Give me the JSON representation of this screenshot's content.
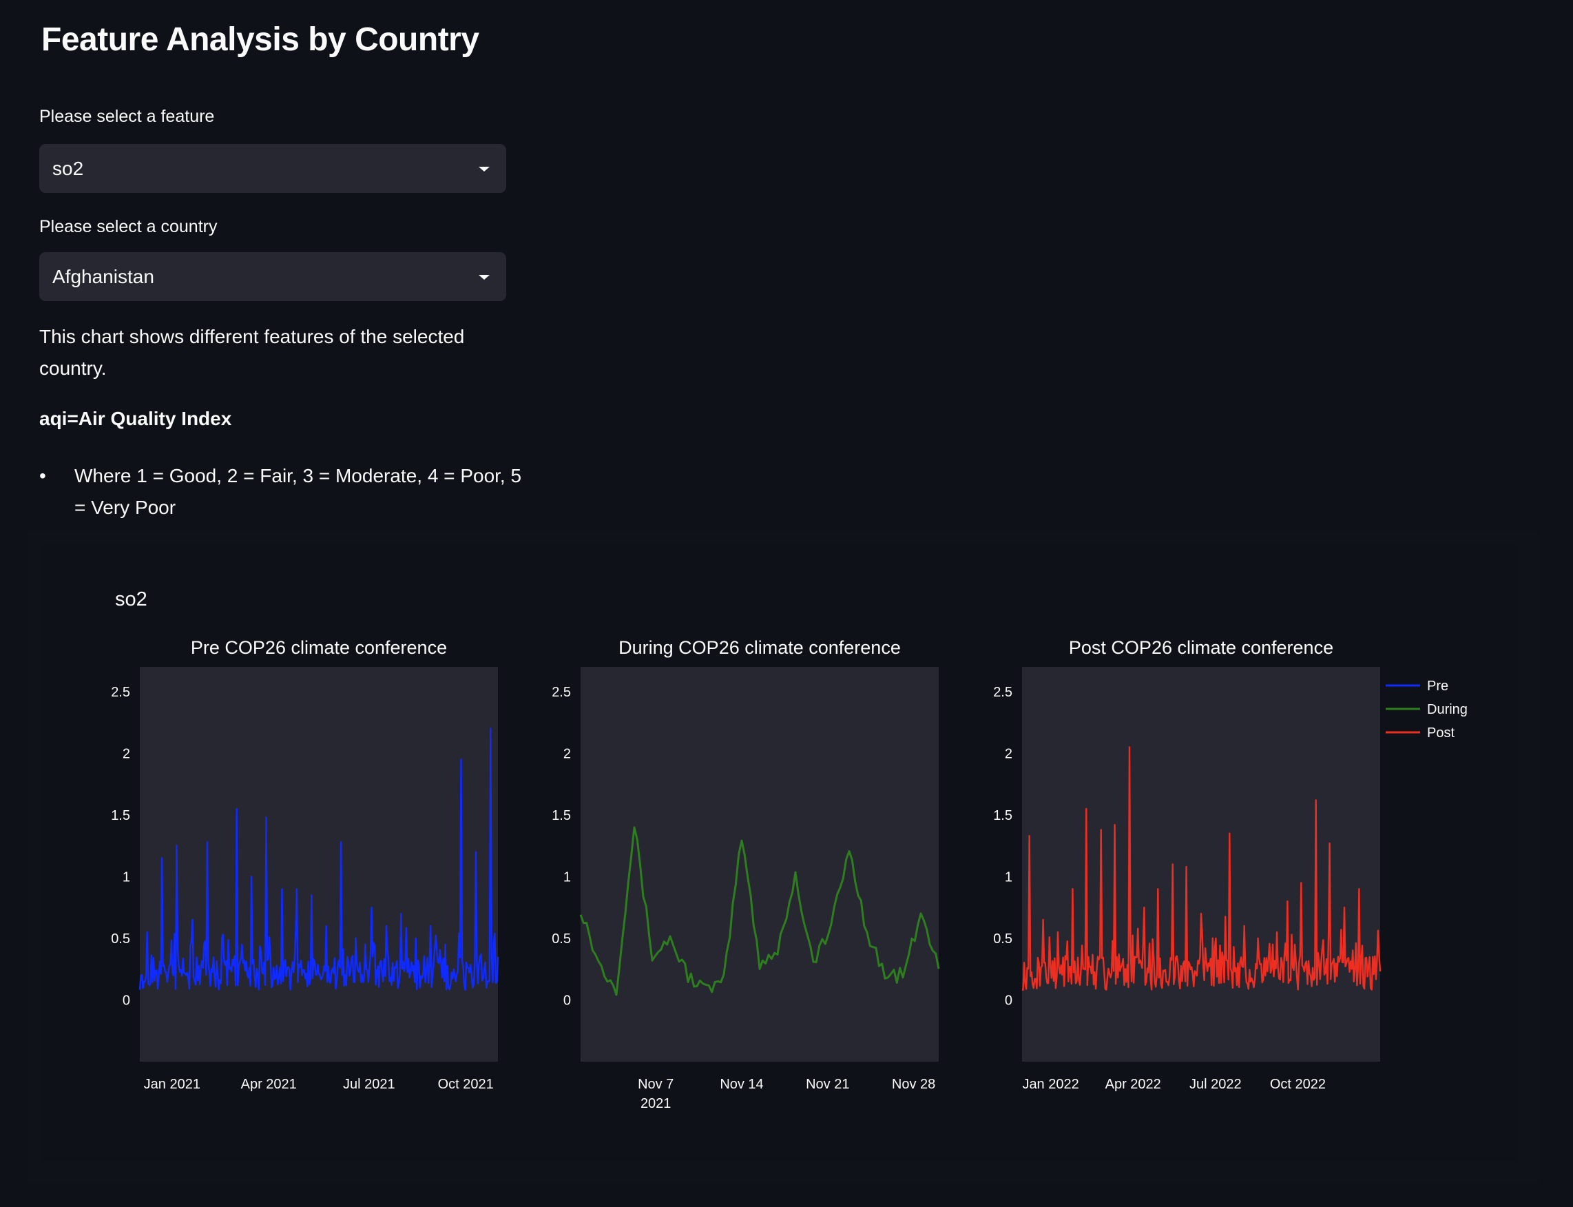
{
  "page": {
    "title": "Feature Analysis by Country"
  },
  "feature_select": {
    "label": "Please select a feature",
    "value": "so2"
  },
  "country_select": {
    "label": "Please select a country",
    "value": "Afghanistan"
  },
  "description": "This chart shows different features of the selected country.",
  "aqi_heading": "aqi=Air Quality Index",
  "aqi_bullet": "Where 1 = Good, 2 = Fair, 3 = Moderate, 4 = Poor, 5 = Very Poor",
  "icons": {
    "select_chevron": "caret-down-icon"
  },
  "colors": {
    "background": "#0e1117",
    "plot_bg": "#262730",
    "pre": "#0f2bff",
    "during": "#2e7d1e",
    "post": "#ef2e22"
  },
  "chart_data": {
    "type": "line",
    "title": "so2",
    "y_ticks": [
      "0",
      "0.5",
      "1",
      "1.5",
      "2",
      "2.5"
    ],
    "ylim": [
      -0.5,
      2.7
    ],
    "legend": {
      "placement": "top-right",
      "entries": [
        "Pre",
        "During",
        "Post"
      ]
    },
    "panels": [
      {
        "title": "Pre COP26 climate conference",
        "series_name": "Pre",
        "x_range": [
          "2020-12-01",
          "2021-10-31"
        ],
        "x_ticks": [
          "Jan 2021",
          "Apr 2021",
          "Jul 2021",
          "Oct 2021"
        ],
        "approx_x": [
          "2020-12-01",
          "2020-12-20",
          "2021-01-10",
          "2021-01-25",
          "2021-02-15",
          "2021-02-28",
          "2021-03-10",
          "2021-03-20",
          "2021-04-05",
          "2021-04-20",
          "2021-05-01",
          "2021-05-10",
          "2021-05-25",
          "2021-06-10",
          "2021-06-25",
          "2021-07-10",
          "2021-07-25",
          "2021-08-10",
          "2021-08-25",
          "2021-09-10",
          "2021-09-25",
          "2021-10-05",
          "2021-10-20",
          "2021-10-31"
        ],
        "approx_peaks": [
          0.55,
          1.15,
          1.25,
          0.65,
          1.28,
          0.5,
          1.55,
          1.0,
          1.48,
          0.9,
          0.9,
          0.85,
          0.6,
          1.28,
          0.5,
          0.75,
          0.6,
          0.7,
          0.5,
          0.6,
          0.45,
          1.95,
          1.2,
          2.2
        ]
      },
      {
        "title": "During COP26 climate conference",
        "series_name": "During",
        "x_range": [
          "2021-11-01",
          "2021-11-30"
        ],
        "x_ticks": [
          "Nov 7",
          "2021",
          "Nov 14",
          "Nov 21",
          "Nov 28"
        ],
        "approx_x": [
          "2021-11-01",
          "2021-11-02",
          "2021-11-04",
          "2021-11-05",
          "2021-11-07",
          "2021-11-09",
          "2021-11-11",
          "2021-11-13",
          "2021-11-14",
          "2021-11-15",
          "2021-11-17",
          "2021-11-18",
          "2021-11-19",
          "2021-11-20",
          "2021-11-22",
          "2021-11-23",
          "2021-11-24",
          "2021-11-26",
          "2021-11-28",
          "2021-11-29",
          "2021-11-30"
        ],
        "approx_y": [
          0.75,
          0.3,
          0.1,
          1.42,
          0.35,
          0.5,
          0.2,
          0.08,
          0.15,
          1.33,
          0.3,
          0.4,
          1.0,
          0.3,
          0.6,
          1.22,
          0.55,
          0.2,
          0.2,
          0.68,
          0.3
        ]
      },
      {
        "title": "Post COP26 climate conference",
        "series_name": "Post",
        "x_range": [
          "2021-12-01",
          "2022-12-31"
        ],
        "x_ticks": [
          "Jan 2022",
          "Apr 2022",
          "Jul 2022",
          "Oct 2022"
        ],
        "approx_x": [
          "2021-12-01",
          "2021-12-15",
          "2022-01-05",
          "2022-01-25",
          "2022-02-10",
          "2022-02-20",
          "2022-03-01",
          "2022-03-10",
          "2022-03-25",
          "2022-04-10",
          "2022-04-25",
          "2022-05-15",
          "2022-06-01",
          "2022-06-20",
          "2022-07-05",
          "2022-07-20",
          "2022-08-10",
          "2022-09-01",
          "2022-09-20",
          "2022-10-01",
          "2022-10-15",
          "2022-11-01",
          "2022-11-20",
          "2022-12-10",
          "2022-12-31"
        ],
        "approx_peaks": [
          1.33,
          0.65,
          0.55,
          0.9,
          1.55,
          1.38,
          1.42,
          2.05,
          0.75,
          0.9,
          1.1,
          1.08,
          0.7,
          0.5,
          1.35,
          0.6,
          0.5,
          0.45,
          0.8,
          0.95,
          1.62,
          1.27,
          0.75,
          0.9,
          0.35
        ]
      }
    ]
  }
}
